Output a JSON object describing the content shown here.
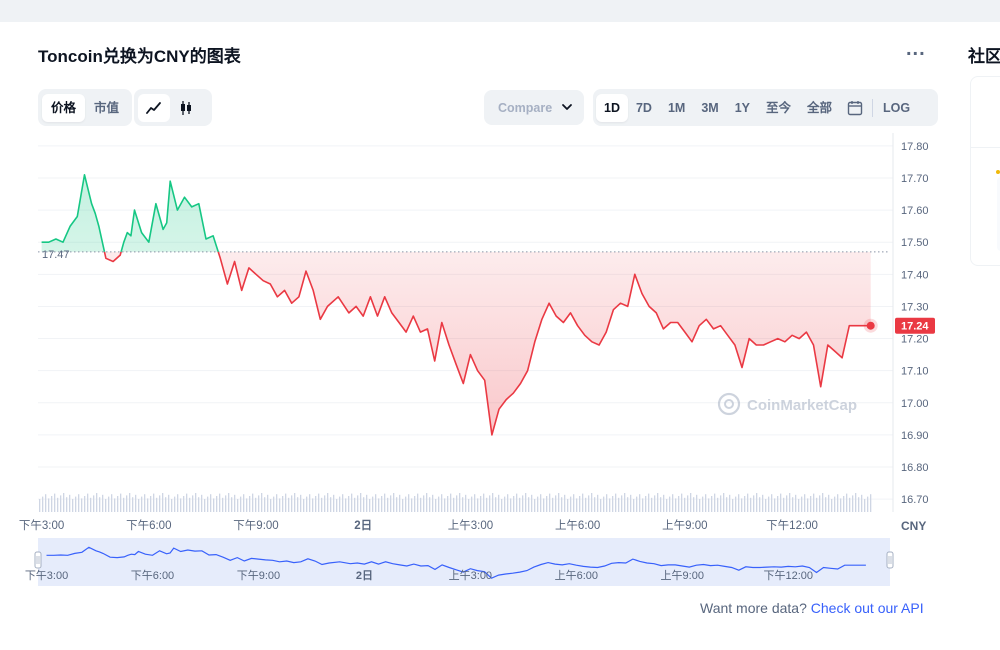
{
  "page": {
    "title": "Toncoin兑换为CNY的图表",
    "more_label": "...",
    "side_title": "社区"
  },
  "toolbar": {
    "metric_tabs": [
      {
        "label": "价格",
        "active": true
      },
      {
        "label": "市值",
        "active": false
      }
    ],
    "chart_types": [
      {
        "icon": "line-chart-icon",
        "active": true
      },
      {
        "icon": "candlestick-icon",
        "active": false
      }
    ],
    "compare_label": "Compare 1",
    "ranges": [
      {
        "label": "1D",
        "active": true
      },
      {
        "label": "7D",
        "active": false
      },
      {
        "label": "1M",
        "active": false
      },
      {
        "label": "3M",
        "active": false
      },
      {
        "label": "1Y",
        "active": false
      },
      {
        "label": "至今",
        "active": false
      },
      {
        "label": "全部",
        "active": false
      }
    ],
    "calendar_icon": "calendar-icon",
    "log_label": "LOG"
  },
  "footer": {
    "api_prefix": "Want more data? ",
    "api_link": "Check out our API"
  },
  "chart_data": {
    "type": "line",
    "currency": "CNY",
    "watermark": "CoinMarketCap",
    "baseline": 17.47,
    "baseline_label": "17.47",
    "current_label": "17.24",
    "ylim": [
      16.66,
      17.84
    ],
    "y_ticks": [
      17.8,
      17.7,
      17.6,
      17.5,
      17.4,
      17.3,
      17.2,
      17.1,
      17.0,
      16.9,
      16.8,
      16.7
    ],
    "y_tick_labels": [
      "17.80",
      "17.70",
      "17.60",
      "17.50",
      "17.40",
      "17.30",
      "17.20",
      "17.10",
      "17.00",
      "16.90",
      "16.80",
      "16.70"
    ],
    "x_ticks": [
      {
        "label": "下午3:00",
        "t": 0
      },
      {
        "label": "下午6:00",
        "t": 3
      },
      {
        "label": "下午9:00",
        "t": 6
      },
      {
        "label": "2日",
        "t": 9
      },
      {
        "label": "上午3:00",
        "t": 12
      },
      {
        "label": "上午6:00",
        "t": 15
      },
      {
        "label": "上午9:00",
        "t": 18
      },
      {
        "label": "下午12:00",
        "t": 21
      }
    ],
    "xlim": [
      -0.1,
      23.74
    ],
    "series": [
      {
        "x": [
          0,
          0.2,
          0.4,
          0.6,
          0.8,
          1.0,
          1.2,
          1.4,
          1.5,
          1.6,
          1.8,
          2.0,
          2.2,
          2.3,
          2.4,
          2.5,
          2.6,
          2.8,
          3.0,
          3.2,
          3.4,
          3.5,
          3.6,
          3.8,
          4.0,
          4.2,
          4.4,
          4.6,
          4.8,
          5.0,
          5.2,
          5.4,
          5.6,
          5.8,
          6.0,
          6.2,
          6.4,
          6.6,
          6.8,
          7.0,
          7.2,
          7.4,
          7.6,
          7.8,
          8.0,
          8.3,
          8.6,
          8.8,
          9.0,
          9.2,
          9.4,
          9.6,
          9.8,
          10.0,
          10.2,
          10.4,
          10.6,
          10.8,
          11.0,
          11.2,
          11.4,
          11.6,
          11.8,
          12.0,
          12.2,
          12.4,
          12.6,
          12.8,
          13.0,
          13.2,
          13.4,
          13.6,
          13.8,
          14.0,
          14.2,
          14.4,
          14.6,
          14.8,
          15.0,
          15.2,
          15.4,
          15.6,
          15.8,
          16.0,
          16.2,
          16.4,
          16.6,
          16.8,
          17.0,
          17.2,
          17.4,
          17.6,
          17.8,
          18.0,
          18.2,
          18.4,
          18.6,
          18.8,
          19.0,
          19.2,
          19.4,
          19.6,
          19.8,
          20.0,
          20.2,
          20.4,
          20.6,
          20.8,
          21.0,
          21.2,
          21.4,
          21.6,
          21.8,
          22.0,
          22.2,
          22.4,
          22.6,
          22.8,
          23.0,
          23.2
        ],
        "y": [
          17.5,
          17.5,
          17.51,
          17.5,
          17.55,
          17.58,
          17.71,
          17.62,
          17.59,
          17.55,
          17.45,
          17.44,
          17.46,
          17.5,
          17.53,
          17.52,
          17.6,
          17.53,
          17.5,
          17.62,
          17.54,
          17.56,
          17.69,
          17.6,
          17.64,
          17.61,
          17.62,
          17.51,
          17.52,
          17.45,
          17.37,
          17.44,
          17.35,
          17.42,
          17.4,
          17.38,
          17.37,
          17.33,
          17.35,
          17.31,
          17.33,
          17.41,
          17.35,
          17.26,
          17.3,
          17.33,
          17.28,
          17.3,
          17.27,
          17.33,
          17.27,
          17.33,
          17.28,
          17.25,
          17.22,
          17.27,
          17.22,
          17.23,
          17.13,
          17.25,
          17.18,
          17.12,
          17.06,
          17.15,
          17.1,
          17.07,
          16.9,
          16.98,
          17.01,
          17.03,
          17.06,
          17.1,
          17.19,
          17.26,
          17.31,
          17.27,
          17.25,
          17.28,
          17.24,
          17.21,
          17.19,
          17.18,
          17.22,
          17.29,
          17.31,
          17.3,
          17.4,
          17.34,
          17.3,
          17.28,
          17.23,
          17.25,
          17.25,
          17.22,
          17.19,
          17.24,
          17.26,
          17.23,
          17.24,
          17.21,
          17.18,
          17.11,
          17.2,
          17.18,
          17.18,
          17.19,
          17.2,
          17.19,
          17.21,
          17.2,
          17.22,
          17.18,
          17.05,
          17.18,
          17.16,
          17.14,
          17.24,
          17.24,
          17.24,
          17.24
        ]
      }
    ],
    "x_axis_unit_label": "CNY"
  }
}
